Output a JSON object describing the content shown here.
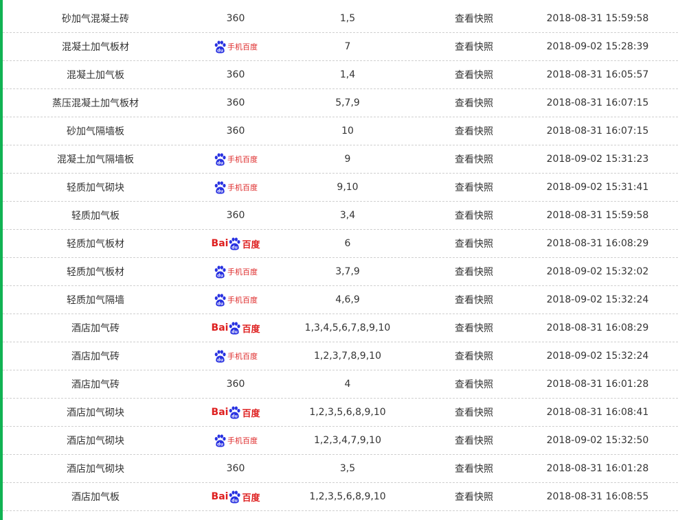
{
  "colors": {
    "accent": "#11b353",
    "baidu_blue": "#2932e1",
    "baidu_red": "#de1f1f",
    "divider": "#cfcfcf"
  },
  "rows": [
    {
      "keyword": "砂加气混凝土砖",
      "engine": "360",
      "engine_label": "360",
      "ranks": "1,5",
      "snapshot": "查看快照",
      "time": "2018-08-31 15:59:58"
    },
    {
      "keyword": "混凝土加气板材",
      "engine": "baidu-mobile",
      "engine_label": "手机百度",
      "ranks": "7",
      "snapshot": "查看快照",
      "time": "2018-09-02 15:28:39"
    },
    {
      "keyword": "混凝土加气板",
      "engine": "360",
      "engine_label": "360",
      "ranks": "1,4",
      "snapshot": "查看快照",
      "time": "2018-08-31 16:05:57"
    },
    {
      "keyword": "蒸压混凝土加气板材",
      "engine": "360",
      "engine_label": "360",
      "ranks": "5,7,9",
      "snapshot": "查看快照",
      "time": "2018-08-31 16:07:15"
    },
    {
      "keyword": "砂加气隔墙板",
      "engine": "360",
      "engine_label": "360",
      "ranks": "10",
      "snapshot": "查看快照",
      "time": "2018-08-31 16:07:15"
    },
    {
      "keyword": "混凝土加气隔墙板",
      "engine": "baidu-mobile",
      "engine_label": "手机百度",
      "ranks": "9",
      "snapshot": "查看快照",
      "time": "2018-09-02 15:31:23"
    },
    {
      "keyword": "轻质加气砌块",
      "engine": "baidu-mobile",
      "engine_label": "手机百度",
      "ranks": "9,10",
      "snapshot": "查看快照",
      "time": "2018-09-02 15:31:41"
    },
    {
      "keyword": "轻质加气板",
      "engine": "360",
      "engine_label": "360",
      "ranks": "3,4",
      "snapshot": "查看快照",
      "time": "2018-08-31 15:59:58"
    },
    {
      "keyword": "轻质加气板材",
      "engine": "baidu",
      "engine_label": "百度",
      "ranks": "6",
      "snapshot": "查看快照",
      "time": "2018-08-31 16:08:29"
    },
    {
      "keyword": "轻质加气板材",
      "engine": "baidu-mobile",
      "engine_label": "手机百度",
      "ranks": "3,7,9",
      "snapshot": "查看快照",
      "time": "2018-09-02 15:32:02"
    },
    {
      "keyword": "轻质加气隔墙",
      "engine": "baidu-mobile",
      "engine_label": "手机百度",
      "ranks": "4,6,9",
      "snapshot": "查看快照",
      "time": "2018-09-02 15:32:24"
    },
    {
      "keyword": "酒店加气砖",
      "engine": "baidu",
      "engine_label": "百度",
      "ranks": "1,3,4,5,6,7,8,9,10",
      "snapshot": "查看快照",
      "time": "2018-08-31 16:08:29"
    },
    {
      "keyword": "酒店加气砖",
      "engine": "baidu-mobile",
      "engine_label": "手机百度",
      "ranks": "1,2,3,7,8,9,10",
      "snapshot": "查看快照",
      "time": "2018-09-02 15:32:24"
    },
    {
      "keyword": "酒店加气砖",
      "engine": "360",
      "engine_label": "360",
      "ranks": "4",
      "snapshot": "查看快照",
      "time": "2018-08-31 16:01:28"
    },
    {
      "keyword": "酒店加气砌块",
      "engine": "baidu",
      "engine_label": "百度",
      "ranks": "1,2,3,5,6,8,9,10",
      "snapshot": "查看快照",
      "time": "2018-08-31 16:08:41"
    },
    {
      "keyword": "酒店加气砌块",
      "engine": "baidu-mobile",
      "engine_label": "手机百度",
      "ranks": "1,2,3,4,7,9,10",
      "snapshot": "查看快照",
      "time": "2018-09-02 15:32:50"
    },
    {
      "keyword": "酒店加气砌块",
      "engine": "360",
      "engine_label": "360",
      "ranks": "3,5",
      "snapshot": "查看快照",
      "time": "2018-08-31 16:01:28"
    },
    {
      "keyword": "酒店加气板",
      "engine": "baidu",
      "engine_label": "百度",
      "ranks": "1,2,3,5,6,8,9,10",
      "snapshot": "查看快照",
      "time": "2018-08-31 16:08:55"
    }
  ]
}
